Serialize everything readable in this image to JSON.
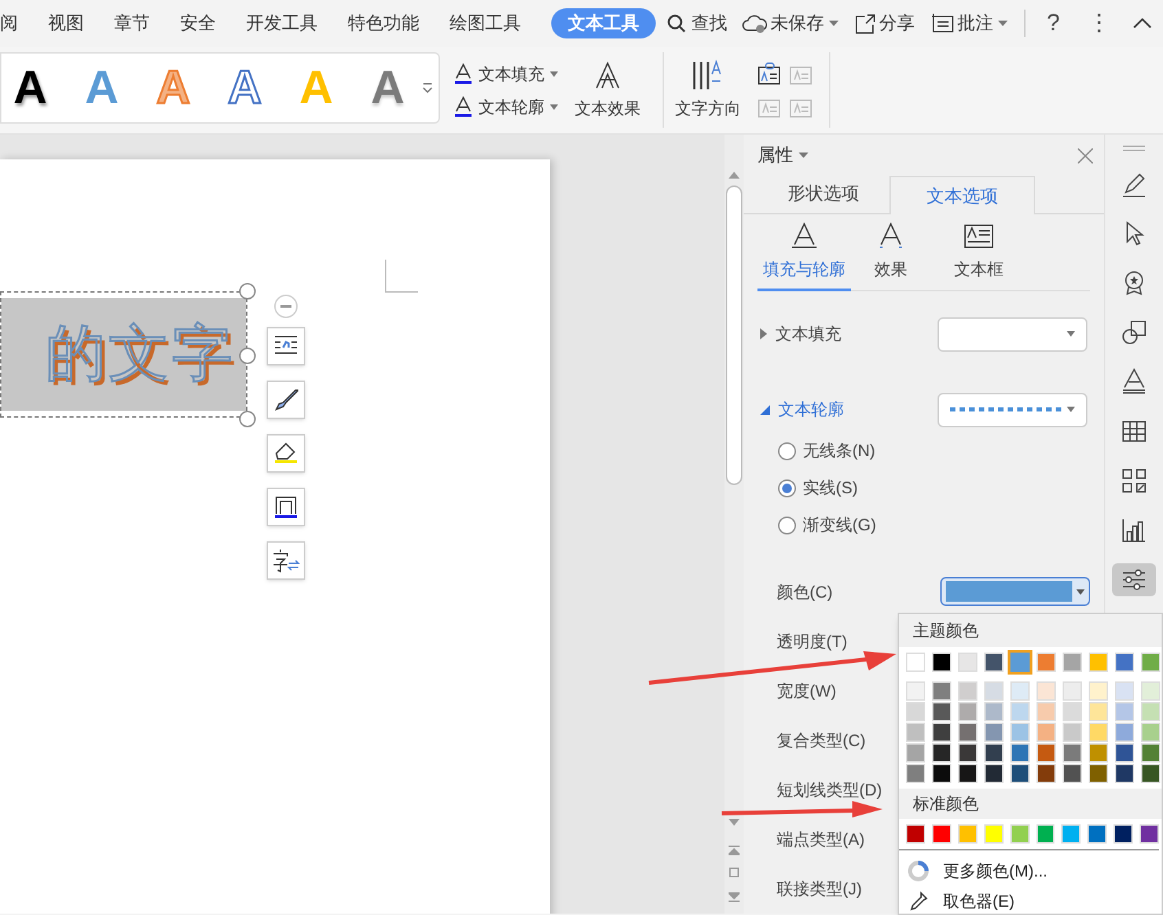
{
  "menu_tabs": [
    {
      "label": "阅",
      "selected": false
    },
    {
      "label": "视图",
      "selected": false
    },
    {
      "label": "章节",
      "selected": false
    },
    {
      "label": "安全",
      "selected": false
    },
    {
      "label": "开发工具",
      "selected": false
    },
    {
      "label": "特色功能",
      "selected": false
    },
    {
      "label": "绘图工具",
      "selected": false
    },
    {
      "label": "文本工具",
      "selected": true
    }
  ],
  "search": {
    "label": "查找"
  },
  "toolbar_right": [
    {
      "label": "未保存",
      "kind": "cloud"
    },
    {
      "label": "分享",
      "kind": "share"
    },
    {
      "label": "批注",
      "kind": "comment"
    }
  ],
  "window_controls": [
    "?",
    "⋮"
  ],
  "wordart_gallery": [
    {
      "glyph": "A",
      "kind": "black"
    },
    {
      "glyph": "A",
      "kind": "blue"
    },
    {
      "glyph": "A",
      "kind": "orange-outline"
    },
    {
      "glyph": "A",
      "kind": "blue-outline"
    },
    {
      "glyph": "A",
      "kind": "gold"
    },
    {
      "glyph": "A",
      "kind": "gray-gradient"
    }
  ],
  "ribbon": {
    "text_fill": "文本填充",
    "text_outline": "文本轮廓",
    "text_effect": "文本效果",
    "text_direction": "文字方向"
  },
  "document": {
    "wordart_text": "的文字"
  },
  "panel": {
    "title": "属性",
    "tabs": [
      {
        "label": "形状选项",
        "selected": false
      },
      {
        "label": "文本选项",
        "selected": true
      }
    ],
    "subtabs": [
      {
        "label": "填充与轮廓",
        "kind": "fill",
        "selected": true
      },
      {
        "label": "效果",
        "kind": "effect",
        "selected": false
      },
      {
        "label": "文本框",
        "kind": "textbox",
        "selected": false
      }
    ],
    "sections": [
      {
        "label": "文本填充",
        "expanded": false,
        "kind": "fill"
      },
      {
        "label": "文本轮廓",
        "expanded": true,
        "kind": "outline"
      }
    ],
    "line_options": [
      {
        "label": "无线条(N)",
        "selected": false
      },
      {
        "label": "实线(S)",
        "selected": true
      },
      {
        "label": "渐变线(G)",
        "selected": false
      }
    ],
    "properties": [
      "颜色(C)",
      "透明度(T)",
      "宽度(W)",
      "复合类型(C)",
      "短划线类型(D)",
      "端点类型(A)",
      "联接类型(J)"
    ]
  },
  "color_picker": {
    "theme_title": "主题颜色",
    "theme_colors": [
      {
        "color": "#ffffff",
        "selected": false
      },
      {
        "color": "#000000",
        "selected": false
      },
      {
        "color": "#e7e6e6",
        "selected": false
      },
      {
        "color": "#44546a",
        "selected": false
      },
      {
        "color": "#5b9bd5",
        "selected": true
      },
      {
        "color": "#ed7d31",
        "selected": false
      },
      {
        "color": "#a5a5a5",
        "selected": false
      },
      {
        "color": "#ffc000",
        "selected": false
      },
      {
        "color": "#4472c4",
        "selected": false
      },
      {
        "color": "#70ad47",
        "selected": false
      }
    ],
    "shade_rows": [
      {
        "swatches": [
          {
            "color": "#f2f2f2"
          },
          {
            "color": "#7f7f7f"
          },
          {
            "color": "#d0cece"
          },
          {
            "color": "#d6dce4"
          },
          {
            "color": "#deebf6"
          },
          {
            "color": "#fbe5d5"
          },
          {
            "color": "#ededed"
          },
          {
            "color": "#fff2cc"
          },
          {
            "color": "#d9e2f3"
          },
          {
            "color": "#e2efd9"
          }
        ]
      },
      {
        "swatches": [
          {
            "color": "#d8d8d8"
          },
          {
            "color": "#595959"
          },
          {
            "color": "#aeabab"
          },
          {
            "color": "#adb9ca"
          },
          {
            "color": "#bdd7ee"
          },
          {
            "color": "#f7cbac"
          },
          {
            "color": "#dbdbdb"
          },
          {
            "color": "#fee599"
          },
          {
            "color": "#b4c6e7"
          },
          {
            "color": "#c5e0b3"
          }
        ]
      },
      {
        "swatches": [
          {
            "color": "#bfbfbf"
          },
          {
            "color": "#3f3f3f"
          },
          {
            "color": "#757070"
          },
          {
            "color": "#8496b0"
          },
          {
            "color": "#9cc3e5"
          },
          {
            "color": "#f4b183"
          },
          {
            "color": "#c9c9c9"
          },
          {
            "color": "#ffd965"
          },
          {
            "color": "#8eaadb"
          },
          {
            "color": "#a8d08d"
          }
        ]
      },
      {
        "swatches": [
          {
            "color": "#a5a5a5"
          },
          {
            "color": "#262626"
          },
          {
            "color": "#3a3838"
          },
          {
            "color": "#323f4f"
          },
          {
            "color": "#2e75b5"
          },
          {
            "color": "#c55a11"
          },
          {
            "color": "#7b7b7b"
          },
          {
            "color": "#bf9000"
          },
          {
            "color": "#2f5496"
          },
          {
            "color": "#538135"
          }
        ]
      },
      {
        "swatches": [
          {
            "color": "#7f7f7f"
          },
          {
            "color": "#0c0c0c"
          },
          {
            "color": "#171616"
          },
          {
            "color": "#222a35"
          },
          {
            "color": "#1e4e79"
          },
          {
            "color": "#833c0b"
          },
          {
            "color": "#525252"
          },
          {
            "color": "#7f6000"
          },
          {
            "color": "#1f3864"
          },
          {
            "color": "#375623"
          }
        ]
      }
    ],
    "standard_title": "标准颜色",
    "standard_colors": [
      {
        "color": "#c00000"
      },
      {
        "color": "#ff0000"
      },
      {
        "color": "#ffc000"
      },
      {
        "color": "#ffff00"
      },
      {
        "color": "#92d050"
      },
      {
        "color": "#00b050"
      },
      {
        "color": "#00b0f0"
      },
      {
        "color": "#0070c0"
      },
      {
        "color": "#002060"
      },
      {
        "color": "#7030a0"
      }
    ],
    "actions": [
      {
        "label": "更多颜色(M)...",
        "kind": "palette"
      },
      {
        "label": "取色器(E)",
        "kind": "eyedropper"
      }
    ]
  },
  "sidebar_tools": [
    {
      "kind": "pen",
      "selected": false
    },
    {
      "kind": "cursor",
      "selected": false
    },
    {
      "kind": "badge",
      "selected": false
    },
    {
      "kind": "shapes",
      "selected": false
    },
    {
      "kind": "text",
      "selected": false
    },
    {
      "kind": "table",
      "selected": false
    },
    {
      "kind": "grid",
      "selected": false
    },
    {
      "kind": "chart",
      "selected": false
    },
    {
      "kind": "sliders",
      "selected": true
    }
  ]
}
